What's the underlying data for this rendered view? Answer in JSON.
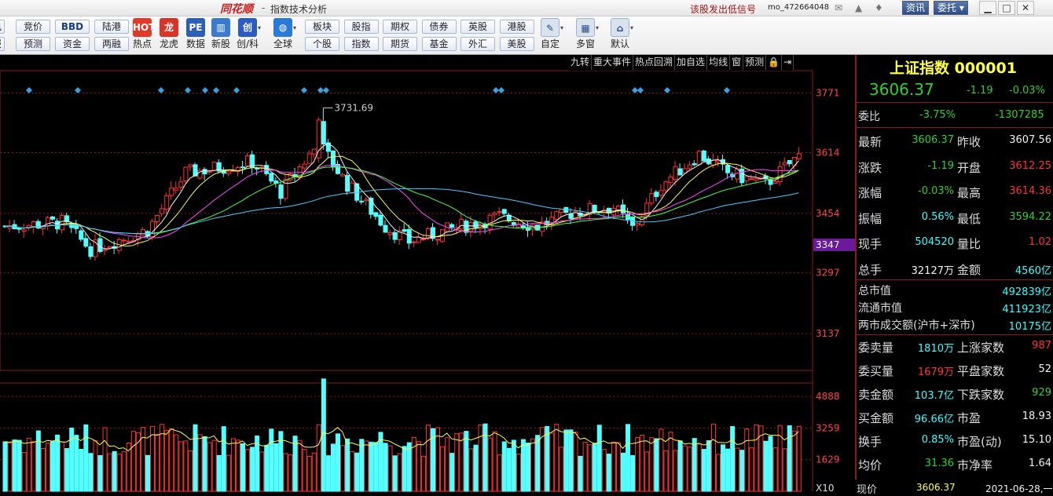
{
  "titlebar": {
    "logo": "同花顺",
    "separator": "-",
    "window_title": "指数技术分析",
    "signal_link": "该股发出低信号",
    "user_id": "mo_472664048",
    "news_button": "资讯",
    "order_button": "委托",
    "icons": [
      "mail-icon",
      "bell-icon",
      "shirt-icon"
    ],
    "window_controls": [
      "minimize",
      "maximize",
      "close"
    ]
  },
  "toolbar": {
    "small_buttons": [
      {
        "label": "竞价",
        "row": 0,
        "col": 0
      },
      {
        "label": "BBD",
        "row": 0,
        "col": 1
      },
      {
        "label": "陆港",
        "row": 0,
        "col": 2
      },
      {
        "label": "预测",
        "row": 1,
        "col": 0
      },
      {
        "label": "资金",
        "row": 1,
        "col": 1
      },
      {
        "label": "两融",
        "row": 1,
        "col": 2
      }
    ],
    "left_cut": [
      "讯",
      "报"
    ],
    "icon_buttons": [
      {
        "label": "热点",
        "icon": "hot-icon",
        "glyph": "HOT",
        "color": "#e23a2a"
      },
      {
        "label": "龙虎",
        "icon": "dragon-icon",
        "glyph": "龙",
        "color": "#d8342a"
      },
      {
        "label": "数据",
        "icon": "pe-icon",
        "glyph": "PE",
        "color": "#2e5fb8"
      },
      {
        "label": "新股",
        "icon": "new-stock-icon",
        "glyph": "▥",
        "color": "#3a7bd0"
      },
      {
        "label": "创/科",
        "icon": "chuang-icon",
        "glyph": "创",
        "color": "#2b5cc4"
      },
      {
        "label": "全球",
        "icon": "globe-icon",
        "glyph": "◍",
        "color": "#2a7ad8"
      }
    ],
    "grid_buttons": [
      {
        "label": "板块"
      },
      {
        "label": "股指"
      },
      {
        "label": "期权"
      },
      {
        "label": "债券"
      },
      {
        "label": "英股"
      },
      {
        "label": "港股"
      },
      {
        "label": "个股"
      },
      {
        "label": "指数"
      },
      {
        "label": "期货"
      },
      {
        "label": "基金"
      },
      {
        "label": "外汇"
      },
      {
        "label": "美股"
      }
    ],
    "right_buttons": [
      {
        "label": "自定",
        "icon": "custom-icon",
        "glyph": "✎"
      },
      {
        "label": "多窗",
        "icon": "multi-window-icon",
        "glyph": "▦"
      },
      {
        "label": "默认",
        "icon": "home-icon",
        "glyph": "⌂"
      }
    ]
  },
  "chart_menu": [
    "九转",
    "重大事件",
    "热点回溯",
    "加自选",
    "均线",
    "窗",
    "预测",
    "🔒",
    "⇥"
  ],
  "chart_data": {
    "type": "candlestick",
    "price_ticks": [
      "3771",
      "3614",
      "3454",
      "3297",
      "3137"
    ],
    "price_tick_values": [
      3771,
      3614,
      3454,
      3297,
      3137
    ],
    "current_price_label": "3347",
    "peak_label": "3731.69",
    "volume_ticks": [
      "4888",
      "3259",
      "1629"
    ],
    "volume_unit_label": "X10",
    "ylim": [
      3040,
      3830
    ],
    "volume_ylim": [
      0,
      5500
    ],
    "colors": {
      "up": "#ff3232",
      "down": "#54ffff",
      "ma5": "#f0f0f0",
      "ma10": "#ffff44",
      "ma20": "#ff44ff",
      "ma30": "#44ff44",
      "ma60": "#44ccff",
      "grid": "#8a1a1a"
    },
    "signal_diamond_count": 18
  },
  "quote": {
    "name": "上证指数",
    "code": "000001",
    "price": "3606.37",
    "change": "-1.19",
    "change_pct": "-0.03%",
    "weibi_label": "委比",
    "weibi_pct": "-3.75%",
    "weibi_diff": "-1307285",
    "rows": [
      {
        "l1": "最新",
        "v1": "3606.37",
        "c1": "dn",
        "l2": "昨收",
        "v2": "3607.56",
        "c2": "wh"
      },
      {
        "l1": "涨跌",
        "v1": "-1.19",
        "c1": "dn",
        "l2": "开盘",
        "v2": "3612.25",
        "c2": "up"
      },
      {
        "l1": "涨幅",
        "v1": "-0.03%",
        "c1": "dn",
        "l2": "最高",
        "v2": "3614.36",
        "c2": "up"
      },
      {
        "l1": "振幅",
        "v1": "0.56%",
        "c1": "cy",
        "l2": "最低",
        "v2": "3594.22",
        "c2": "dn"
      },
      {
        "l1": "现手",
        "v1": "504520",
        "c1": "cy",
        "l2": "量比",
        "v2": "1.02",
        "c2": "up"
      },
      {
        "l1": "总手",
        "v1": "32127万",
        "c1": "wh",
        "l2": "金额",
        "v2": "4560亿",
        "c2": "cy"
      }
    ],
    "market": [
      {
        "l": "总市值",
        "v": "492839亿"
      },
      {
        "l": "流通市值",
        "v": "411923亿"
      },
      {
        "l": "两市成交额(沪市+深市)",
        "v": "10175亿"
      }
    ],
    "stats": [
      {
        "l1": "委卖量",
        "v1": "1810万",
        "c1": "cy",
        "l2": "上涨家数",
        "v2": "987",
        "c2": "up"
      },
      {
        "l1": "委买量",
        "v1": "1679万",
        "c1": "up",
        "l2": "平盘家数",
        "v2": "52",
        "c2": "wh"
      },
      {
        "l1": "卖金额",
        "v1": "103.7亿",
        "c1": "cy",
        "l2": "下跌家数",
        "v2": "929",
        "c2": "dn"
      },
      {
        "l1": "买金额",
        "v1": "96.66亿",
        "c1": "cy",
        "l2": "市盈",
        "v2": "18.93",
        "c2": "wh"
      },
      {
        "l1": "换手",
        "v1": "0.85%",
        "c1": "cy",
        "l2": "市盈(动)",
        "v2": "15.10",
        "c2": "wh"
      },
      {
        "l1": "均价",
        "v1": "31.36",
        "c1": "dn",
        "l2": "市净率",
        "v2": "1.64",
        "c2": "wh"
      }
    ],
    "bottom_label": "现价",
    "bottom_price": "3606.37",
    "bottom_date": "2021-06-28,一"
  }
}
